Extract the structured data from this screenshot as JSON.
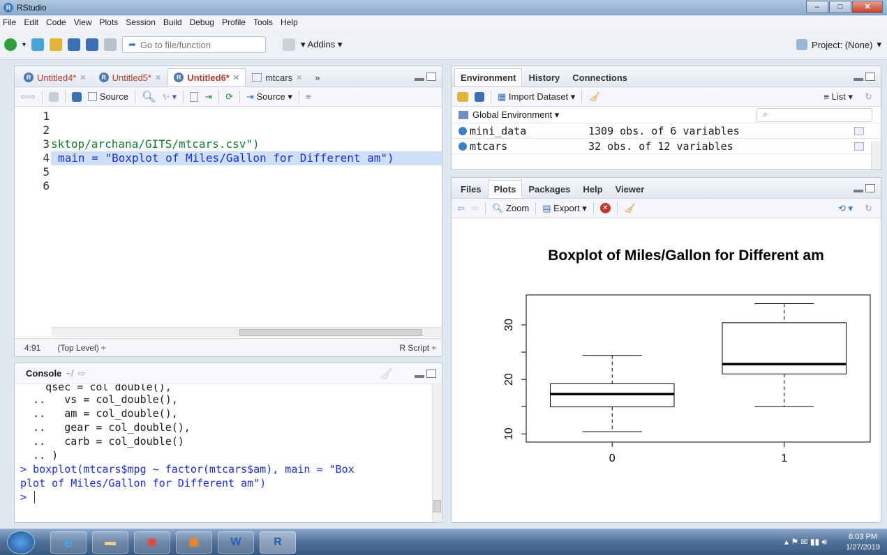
{
  "window": {
    "title": "RStudio",
    "app_icon": "R"
  },
  "menu": [
    "File",
    "Edit",
    "Code",
    "View",
    "Plots",
    "Session",
    "Build",
    "Debug",
    "Profile",
    "Tools",
    "Help"
  ],
  "toolbar": {
    "goto_placeholder": "Go to file/function",
    "addins": "Addins",
    "project": "Project: (None)"
  },
  "editor": {
    "tabs": [
      {
        "label": "Untitled4*",
        "active": false
      },
      {
        "label": "Untitled5*",
        "active": false
      },
      {
        "label": "Untitled6*",
        "active": true
      },
      {
        "label": "mtcars",
        "active": false
      }
    ],
    "source_check": "Source",
    "source_btn": "Source",
    "line_numbers": [
      "1",
      "2",
      "3",
      "4",
      "5",
      "6"
    ],
    "lines": [
      "",
      "",
      "sktop/archana/GITS/mtcars.csv\")",
      "main = \"Boxplot of Miles/Gallon for Different am\")",
      "",
      ""
    ],
    "status": {
      "pos": "4:91",
      "scope": "(Top Level) ÷",
      "type": "R Script ÷"
    }
  },
  "console": {
    "title": "Console",
    "path": "~/",
    "lines": [
      "    qsec = col_double(),",
      "  ..   vs = col_double(),",
      "  ..   am = col_double(),",
      "  ..   gear = col_double(),",
      "  ..   carb = col_double()",
      "  .. )"
    ],
    "cmd1": "> boxplot(mtcars$mpg ~ factor(mtcars$am), main = \"Box",
    "cmd2": "plot of Miles/Gallon for Different am\")",
    "prompt": ">"
  },
  "env": {
    "tabs": [
      "Environment",
      "History",
      "Connections"
    ],
    "import": "Import Dataset",
    "list": "List",
    "scope": "Global Environment",
    "rows": [
      {
        "name": "mini_data",
        "value": "1309 obs. of 6 variables"
      },
      {
        "name": "mtcars",
        "value": "32 obs. of 12 variables"
      }
    ]
  },
  "files": {
    "tabs": [
      "Files",
      "Plots",
      "Packages",
      "Help",
      "Viewer"
    ],
    "zoom": "Zoom",
    "export": "Export"
  },
  "chart_data": {
    "type": "boxplot",
    "title": "Boxplot of Miles/Gallon for Different am",
    "categories": [
      "0",
      "1"
    ],
    "boxes": [
      {
        "label": "0",
        "min": 10.4,
        "q1": 14.95,
        "median": 17.3,
        "q3": 19.2,
        "max": 24.4
      },
      {
        "label": "1",
        "min": 15.0,
        "q1": 21.0,
        "median": 22.8,
        "q3": 30.4,
        "max": 33.9
      }
    ],
    "yticks": [
      "10",
      "20",
      "30"
    ],
    "ylim": [
      8.5,
      35.5
    ],
    "xlabel": "",
    "ylabel": ""
  },
  "taskbar": {
    "time": "6:03 PM",
    "date": "1/27/2019"
  },
  "colors": {
    "accent": "#3b7bbf",
    "string": "#127b2f",
    "console_cmd": "#1b2fd1"
  }
}
